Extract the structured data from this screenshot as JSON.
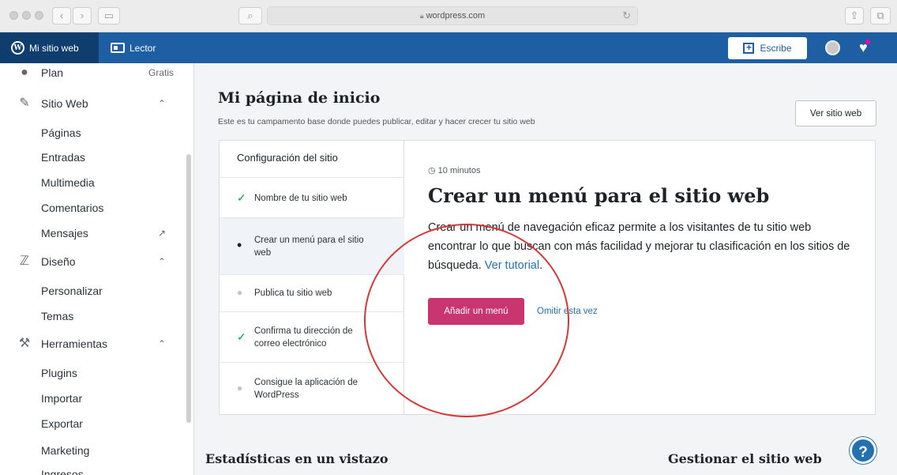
{
  "browser": {
    "url": "wordpress.com",
    "icons": [
      "back-icon",
      "forward-icon",
      "sidebar-icon",
      "search-icon",
      "lock-icon",
      "reload-icon",
      "share-icon",
      "tabs-icon"
    ]
  },
  "masterbar": {
    "my_site": "Mi sitio web",
    "reader": "Lector",
    "write": "Escribe"
  },
  "sidebar": {
    "plan_label": "Plan",
    "plan_badge": "Gratis",
    "site_label": "Sitio Web",
    "pages": "Páginas",
    "posts": "Entradas",
    "media": "Multimedia",
    "comments": "Comentarios",
    "messages": "Mensajes",
    "design_label": "Diseño",
    "customize": "Personalizar",
    "themes": "Temas",
    "tools_label": "Herramientas",
    "plugins": "Plugins",
    "import": "Importar",
    "export": "Exportar",
    "marketing": "Marketing",
    "earn": "Ingresos"
  },
  "main": {
    "title": "Mi página de inicio",
    "subtitle": "Este es tu campamento base donde puedes publicar, editar y hacer crecer tu sitio web",
    "view_site": "Ver sitio web",
    "checklist": {
      "heading": "Configuración del sitio",
      "tasks": [
        {
          "label": "Nombre de tu sitio web",
          "status": "done"
        },
        {
          "label": "Crear un menú para el sitio web",
          "status": "current"
        },
        {
          "label": "Publica tu sitio web",
          "status": "pending"
        },
        {
          "label": "Confirma tu dirección de correo electrónico",
          "status": "done"
        },
        {
          "label": "Consigue la aplicación de WordPress",
          "status": "pending"
        }
      ]
    },
    "detail": {
      "time": "10 minutos",
      "title": "Crear un menú para el sitio web",
      "desc": "Crear un menú de navegación eficaz permite a los visitantes de tu sitio web encontrar lo que buscan con más facilidad y mejorar tu clasificación en los sitios de búsqueda.",
      "tutorial_link": "Ver tutorial",
      "add_menu": "Añadir un menú",
      "skip": "Omitir esta vez"
    },
    "stats_title": "Estadísticas en un vistazo",
    "manage_title": "Gestionar el sitio web",
    "help": "?"
  },
  "colors": {
    "masterbar": "#1e5fa3",
    "primary_button": "#c9356e",
    "link": "#2271b1",
    "annotation_circle": "#d63638",
    "check": "#00a32a"
  }
}
